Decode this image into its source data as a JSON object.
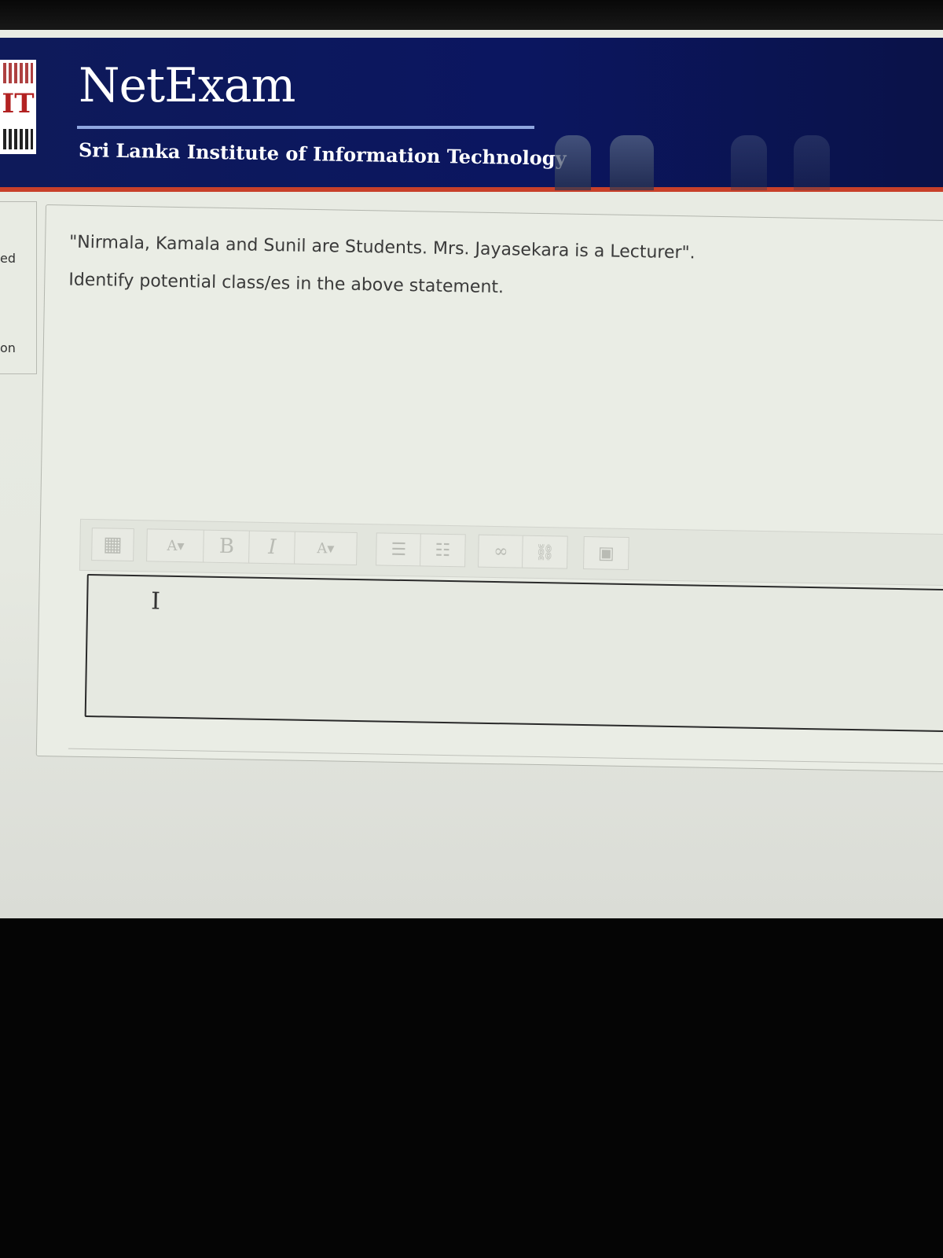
{
  "header": {
    "logo_text": "IT",
    "title": "NetExam",
    "subtitle": "Sri Lanka Institute of Information Technology"
  },
  "sidebar": {
    "fragments": [
      "ed",
      "on"
    ]
  },
  "question": {
    "line1": "\"Nirmala, Kamala and Sunil are Students. Mrs. Jayasekara is a Lecturer\".",
    "line2": "Identify potential class/es in the above statement."
  },
  "editor": {
    "toolbar": [
      {
        "name": "toolbar-toggle-icon",
        "glyph": "▦"
      },
      {
        "name": "paragraph-style-icon",
        "glyph": "A▾"
      },
      {
        "name": "bold-icon",
        "glyph": "B"
      },
      {
        "name": "italic-icon",
        "glyph": "I"
      },
      {
        "name": "font-color-icon",
        "glyph": "A▾"
      },
      {
        "name": "unordered-list-icon",
        "glyph": "☰"
      },
      {
        "name": "ordered-list-icon",
        "glyph": "☷"
      },
      {
        "name": "link-icon",
        "glyph": "∞"
      },
      {
        "name": "unlink-icon",
        "glyph": "⛓"
      },
      {
        "name": "image-icon",
        "glyph": "▣"
      }
    ],
    "answer_value": "",
    "cursor_glyph": "I"
  },
  "colors": {
    "header_bg": "#0b1660",
    "header_accent": "#c8402a",
    "page_bg": "#e9ece4"
  }
}
